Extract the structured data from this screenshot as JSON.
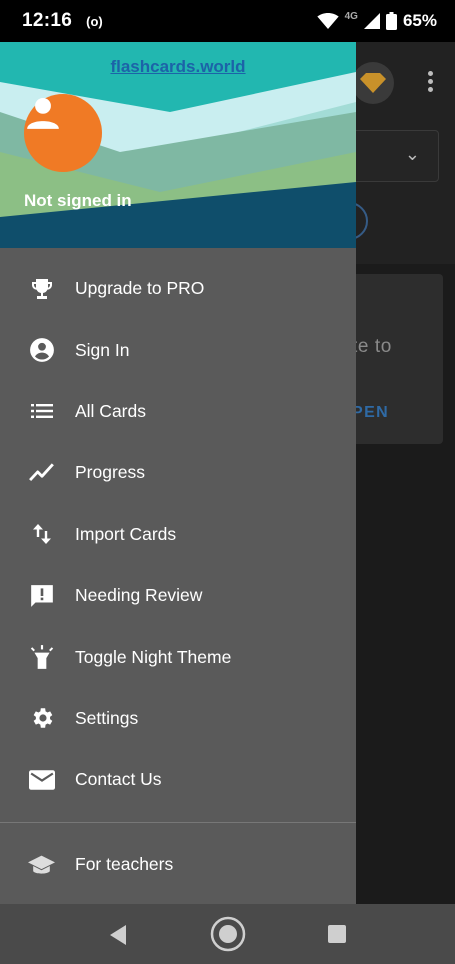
{
  "status_bar": {
    "time": "12:16",
    "radio_icon_text": "(o)",
    "network_type": "4G",
    "battery_percent": "65%"
  },
  "drawer": {
    "header": {
      "site_link": "flashcards.world",
      "user_status": "Not signed in",
      "avatar_color": "#f07a25"
    },
    "items": [
      {
        "label": "Upgrade to PRO",
        "icon": "trophy-icon"
      },
      {
        "label": "Sign In",
        "icon": "account-circle-icon"
      },
      {
        "label": "All Cards",
        "icon": "list-icon"
      },
      {
        "label": "Progress",
        "icon": "trending-up-icon"
      },
      {
        "label": "Import Cards",
        "icon": "import-export-icon"
      },
      {
        "label": "Needing Review",
        "icon": "feedback-icon"
      },
      {
        "label": "Toggle Night Theme",
        "icon": "flashlight-icon"
      },
      {
        "label": "Settings",
        "icon": "gear-icon"
      },
      {
        "label": "Contact Us",
        "icon": "mail-icon"
      }
    ],
    "bottom_items": [
      {
        "label": "For teachers",
        "icon": "school-icon"
      }
    ]
  },
  "background_app": {
    "card_text": "te to",
    "card_action": "PEN"
  },
  "colors": {
    "drawer_bg": "#5a5a5a",
    "accent_link": "#1c63a8",
    "header_dark": "#0f4e6b"
  }
}
